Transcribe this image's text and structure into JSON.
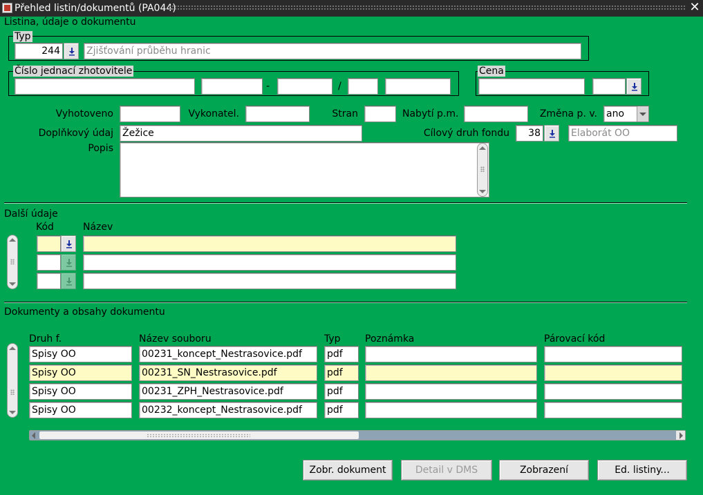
{
  "window": {
    "title": "Přehled listin/dokumentů (PA044)",
    "close_glyph": "✕"
  },
  "section_listina": {
    "title": "Listina, údaje o dokumentu"
  },
  "typ": {
    "label": "Typ",
    "code": "244",
    "description": "Zjišťování průběhu hranic"
  },
  "cislo_jednaci": {
    "label": "Číslo jednací zhotovitele",
    "sep_dash": "-",
    "sep_slash": "/",
    "parts": [
      "",
      "",
      "",
      "",
      ""
    ]
  },
  "cena": {
    "label": "Cena",
    "value": "",
    "currency": ""
  },
  "vyhotoveno": {
    "label": "Vyhotoveno",
    "value": ""
  },
  "vykonatel": {
    "label": "Vykonatel.",
    "value": ""
  },
  "stran": {
    "label": "Stran",
    "value": ""
  },
  "nabyti": {
    "label": "Nabytí p.m.",
    "value": ""
  },
  "zmena": {
    "label": "Změna p. v.",
    "value": "ano"
  },
  "doplnkovy": {
    "label": "Doplňkový údaj",
    "value": "Žežice"
  },
  "cilovy": {
    "label": "Cílový druh fondu",
    "code": "38",
    "description": "Elaborát OO"
  },
  "popis": {
    "label": "Popis",
    "value": ""
  },
  "dalsi": {
    "title": "Další údaje",
    "col_kod": "Kód",
    "col_nazev": "Název",
    "rows": [
      {
        "kod": "",
        "nazev": ""
      },
      {
        "kod": "",
        "nazev": ""
      },
      {
        "kod": "",
        "nazev": ""
      }
    ]
  },
  "dokumenty": {
    "title": "Dokumenty a obsahy dokumentu",
    "columns": {
      "druh": "Druh f.",
      "nazev": "Název souboru",
      "typ": "Typ",
      "poznamka": "Poznámka",
      "parovaci": "Párovací kód"
    },
    "rows": [
      {
        "druh": "Spisy OO",
        "nazev": "00231_koncept_Nestrasovice.pdf",
        "typ": "pdf",
        "poznamka": "",
        "parovaci": ""
      },
      {
        "druh": "Spisy OO",
        "nazev": "00231_SN_Nestrasovice.pdf",
        "typ": "pdf",
        "poznamka": "",
        "parovaci": ""
      },
      {
        "druh": "Spisy OO",
        "nazev": "00231_ZPH_Nestrasovice.pdf",
        "typ": "pdf",
        "poznamka": "",
        "parovaci": ""
      },
      {
        "druh": "Spisy OO",
        "nazev": "00232_koncept_Nestrasovice.pdf",
        "typ": "pdf",
        "poznamka": "",
        "parovaci": ""
      }
    ]
  },
  "buttons": {
    "zobr": "Zobr. dokument",
    "detail": "Detail v DMS",
    "zobrazeni": "Zobrazení",
    "ed": "Ed. listiny..."
  },
  "colors": {
    "background": "#00a651",
    "current_row": "#fefcc4",
    "frame_label": "#d7d7d7"
  },
  "icons": {
    "lov": "download-arrow-icon",
    "close": "close-icon",
    "app": "app-icon"
  }
}
